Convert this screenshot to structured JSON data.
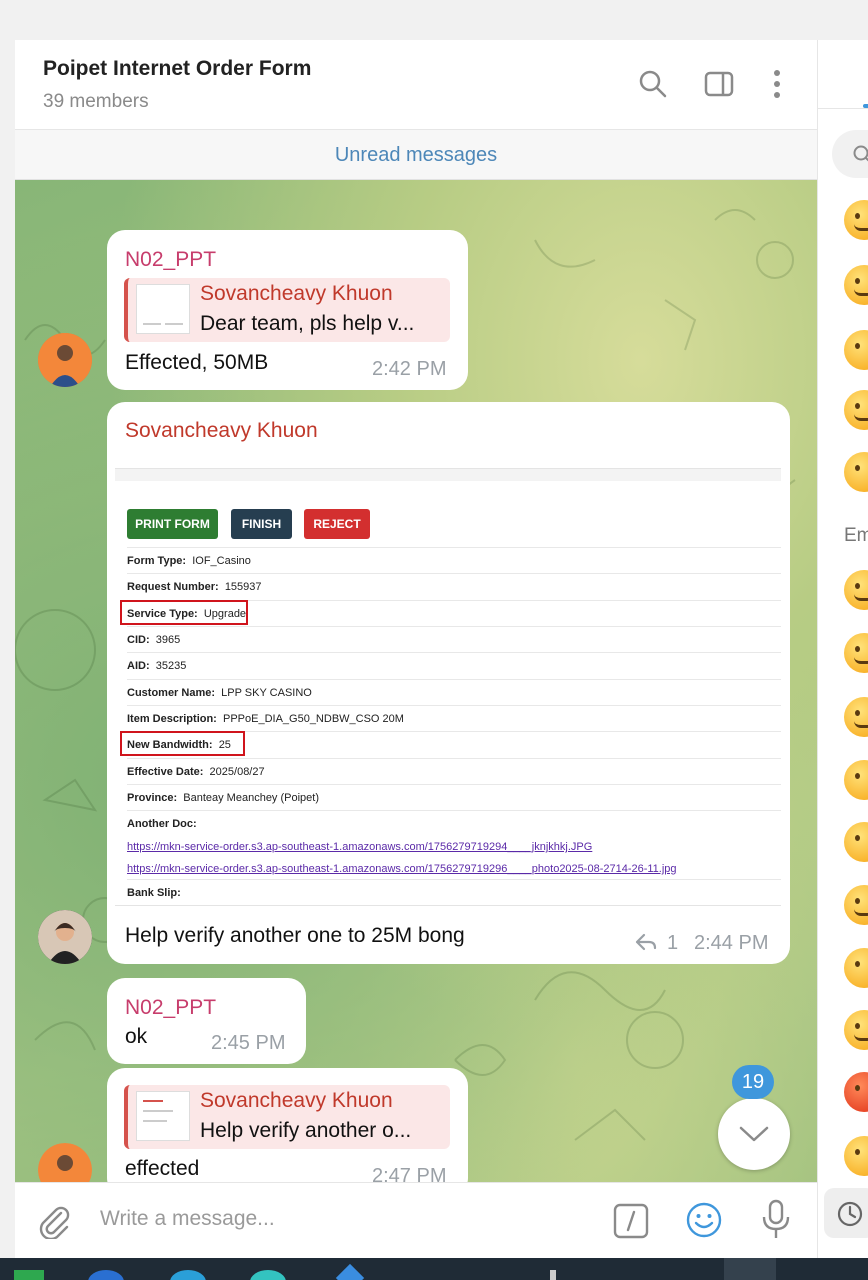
{
  "header": {
    "title": "Poipet Internet Order Form",
    "members": "39 members"
  },
  "unread_label": "Unread messages",
  "messages": [
    {
      "sender": "N02_PPT",
      "reply_name": "Sovancheavy Khuon",
      "reply_text": "Dear team, pls help v...",
      "text": "Effected, 50MB",
      "time": "2:42 PM"
    },
    {
      "sender": "Sovancheavy Khuon",
      "text": "Help verify another one to 25M bong",
      "reply_count": "1",
      "time": "2:44 PM",
      "form": {
        "buttons": [
          {
            "label": "PRINT FORM",
            "color": "#2e7d32"
          },
          {
            "label": "FINISH",
            "color": "#263e50"
          },
          {
            "label": "REJECT",
            "color": "#d32f2f"
          }
        ],
        "fields": [
          {
            "label": "Form Type:",
            "value": "IOF_Casino"
          },
          {
            "label": "Request Number:",
            "value": "155937"
          },
          {
            "label": "Service Type:",
            "value": "Upgrade"
          },
          {
            "label": "CID:",
            "value": "3965"
          },
          {
            "label": "AID:",
            "value": "35235"
          },
          {
            "label": "Customer Name:",
            "value": "LPP SKY CASINO"
          },
          {
            "label": "Item Description:",
            "value": "PPPoE_DIA_G50_NDBW_CSO 20M"
          },
          {
            "label": "New Bandwidth:",
            "value": "25"
          },
          {
            "label": "Effective Date:",
            "value": "2025/08/27"
          },
          {
            "label": "Province:",
            "value": "Banteay Meanchey (Poipet)"
          }
        ],
        "another_doc_label": "Another Doc:",
        "links": [
          "https://mkn-service-order.s3.ap-southeast-1.amazonaws.com/1756279719294____jknjkhkj.JPG",
          "https://mkn-service-order.s3.ap-southeast-1.amazonaws.com/1756279719296____photo2025-08-2714-26-11.jpg"
        ],
        "bank_slip_label": "Bank Slip:"
      }
    },
    {
      "sender": "N02_PPT",
      "text": "ok",
      "time": "2:45 PM"
    },
    {
      "reply_name": "Sovancheavy Khuon",
      "reply_text": "Help verify another o...",
      "text": "effected",
      "time": "2:47 PM"
    }
  ],
  "scroll_badge": "19",
  "composer": {
    "placeholder": "Write a message..."
  },
  "right_panel": {
    "section_label": "Em"
  },
  "colors": {
    "accent": "#4d87b8",
    "badge": "#3f97dc",
    "sender_pink": "#c73d6c",
    "sender_red": "#c0392b"
  }
}
